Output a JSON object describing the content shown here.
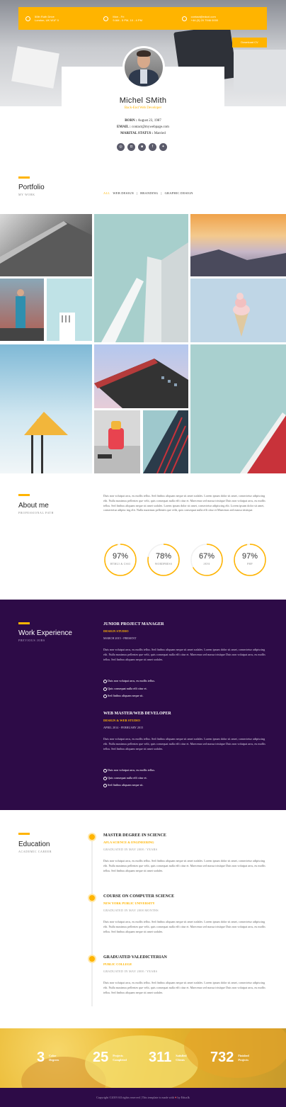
{
  "contact": {
    "items": [
      {
        "icon": "location-icon",
        "line1": "50th Ruth Drive",
        "line2": "London, UK W1F 0"
      },
      {
        "icon": "clock-icon",
        "line1": "Mon - Fri",
        "line2": "9 AM - 5 PM, 10 - 4 PM"
      },
      {
        "icon": "mail-icon",
        "line1": "contact@eduxl.com",
        "line2": "+44 (0) 20 7946 0000"
      }
    ],
    "download_label": "Download CV"
  },
  "profile": {
    "name": "Michel SMith",
    "role": "Back-End Web Developer",
    "born_label": "BORN :",
    "born_value": "August 23, 1987",
    "email_label": "EMAIL :",
    "email_value": "contact@mywebpage.com",
    "marital_label": "MARITAL STATUS :",
    "marital_value": "Married",
    "socials": [
      "dribbble-icon",
      "instagram-icon",
      "linkedin-icon",
      "facebook-icon",
      "twitter-icon"
    ]
  },
  "portfolio": {
    "title": "Portfolio",
    "subtitle": "MY WORK",
    "filters": [
      "ALL",
      "WEB DESIGN",
      "BRANDING",
      "GRAPHIC DESIGN"
    ]
  },
  "about": {
    "title": "About me",
    "subtitle": "PROFESSIONAL PATH",
    "text": "Duis non volutpat arcu, eu mollis tellus. Sed finibus aliquam neque sit amet sodales. Lorem ipsum dolor sit amet, consectetur adipiscing elit. Nulla maximus pellentes que velit, quis consequat nulla effi citur et. Maecenas sed massa tristique Duis non volutpat arcu, eu mollis tellus. Sed finibus aliquam neque sit amet sodales. Lorem ipsum dolor sit amet, consectetur adipiscing elit. Lorem ipsum dolor sit amet, consectetur adipisc ing elit. Nulla maximus pellentes que velit, quis consequat nulla effi citur et Maecenas sed massa tristique.",
    "skills": [
      {
        "value": "97%",
        "percent": 97,
        "label": "HTML5 & CSS3"
      },
      {
        "value": "78%",
        "percent": 78,
        "label": "WORDPRESS"
      },
      {
        "value": "67%",
        "percent": 67,
        "label": "JAVA"
      },
      {
        "value": "97%",
        "percent": 97,
        "label": "PHP"
      }
    ]
  },
  "work": {
    "title": "Work Experience",
    "subtitle": "PREVIOUS JOBS",
    "jobs": [
      {
        "title": "JUNIOR PROJECT MANAGER",
        "company": "DESIGN STUDIO",
        "date": "MARCH 2015 - PRESENT",
        "text": "Duis non volutpat arcu, eu mollis tellus. Sed finibus aliquam neque sit amet sodales. Lorem ipsum dolor sit amet, consectetur adipiscing elit. Nulla maximus pellentes que velit, quis consequat nulla effi citur et. Maecenas sed massa tristique Duis non volutpat arcu, eu mollis tellus. Sed finibus aliquam neque sit amet sodales.",
        "bullets": [
          "Duis non volutpat arcu, eu mollis tellus.",
          "Quis consequat nulla effi citur et.",
          "Sed finibus aliquam neque sit."
        ]
      },
      {
        "title": "WEB MASTER/WEB DEVELOPER",
        "company": "DESIGN & WEB STUDIO",
        "date": "APRIL 2014 - FEBRUARY 2015",
        "text": "Duis non volutpat arcu, eu mollis tellus. Sed finibus aliquam neque sit amet sodales. Lorem ipsum dolor sit amet, consectetur adipiscing elit. Nulla maximus pellentes que velit, quis consequat nulla effi citur et. Maecenas sed massa tristique Duis non volutpat arcu, eu mollis tellus. Sed finibus aliquam neque sit amet sodales.",
        "bullets": [
          "Duis non volutpat arcu, eu mollis tellus.",
          "Quis consequat nulla effi citur et.",
          "Sed finibus aliquam neque sit."
        ]
      }
    ]
  },
  "education": {
    "title": "Education",
    "subtitle": "ACADEMIC CAREER",
    "items": [
      {
        "title": "MASTER DEGREE IN SCIENCE",
        "school": "AFLA SCIENCE & ENGINEERING",
        "date": "GRADUATED IN MAY 2008 / YEARS",
        "text": "Duis non volutpat arcu, eu mollis tellus. Sed finibus aliquam neque sit amet sodales. Lorem ipsum dolor sit amet, consectetur adipiscing elit. Nulla maximus pellentes que velit, quis consequat nulla effi citur et. Maecenas sed massa tristique Duis non volutpat arcu, eu mollis tellus. Sed finibus aliquam neque sit amet sodales."
      },
      {
        "title": "COURSE ON COMPUTER SCIENCE",
        "school": "NEW YORK PUBLIC UNIVERSITY",
        "date": "GRADUATED IN MAY 2008 MONTHS",
        "text": "Duis non volutpat arcu, eu mollis tellus. Sed finibus aliquam neque sit amet sodales. Lorem ipsum dolor sit amet, consectetur adipiscing elit. Nulla maximus pellentes que velit, quis consequat nulla effi citur et. Maecenas sed massa tristique Duis non volutpat arcu, eu mollis tellus. Sed finibus aliquam neque sit amet sodales."
      },
      {
        "title": "GRADUATED VALEDICTERIAN",
        "school": "PUBLIC COLLEGE",
        "date": "GRADUATED IN MAY 2008 / YEARS",
        "text": "Duis non volutpat arcu, eu mollis tellus. Sed finibus aliquam neque sit amet sodales. Lorem ipsum dolor sit amet, consectetur adipiscing elit. Nulla maximus pellentes que velit, quis consequat nulla effi citur et. Maecenas sed massa tristique Duis non volutpat arcu, eu mollis tellus. Sed finibus aliquam neque sit amet sodales."
      }
    ]
  },
  "counters": [
    {
      "number": "3",
      "label1": "Color",
      "label2": "Degrees"
    },
    {
      "number": "25",
      "label1": "Projects",
      "label2": "Completed"
    },
    {
      "number": "311",
      "label1": "Satisfied",
      "label2": "Clients"
    },
    {
      "number": "732",
      "label1": "Finished",
      "label2": "Projects"
    }
  ],
  "footer": {
    "text_before": "Copyright ©2019 All rights reserved | This template is made with",
    "text_after": "by Eduxlk"
  },
  "colors": {
    "accent": "#ffb400",
    "dark": "#2d0b47"
  }
}
